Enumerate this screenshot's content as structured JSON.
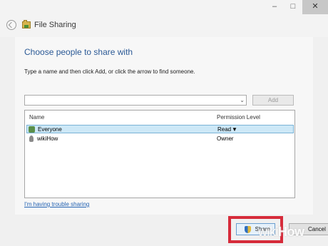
{
  "window": {
    "minimize_glyph": "–",
    "maximize_glyph": "□",
    "close_glyph": "✕"
  },
  "header": {
    "title": "File Sharing"
  },
  "main": {
    "heading": "Choose people to share with",
    "instruction": "Type a name and then click Add, or click the arrow to find someone.",
    "name_input_value": "",
    "dropdown_glyph": "⌄",
    "add_label": "Add"
  },
  "list": {
    "columns": [
      "Name",
      "Permission Level"
    ],
    "rows": [
      {
        "name": "Everyone",
        "permission": "Read",
        "icon": "group-icon",
        "selected": true,
        "has_dropdown": true
      },
      {
        "name": "wikiHow",
        "permission": "Owner",
        "icon": "user-icon",
        "selected": false,
        "has_dropdown": false
      }
    ],
    "permission_dropdown_glyph": "▼"
  },
  "footer": {
    "trouble_link": "I'm having trouble sharing",
    "share_label": "Share",
    "cancel_label": "Cancel"
  },
  "watermark": {
    "part1": "wiki",
    "part2": "How"
  },
  "colors": {
    "accent_heading": "#2c5a96",
    "link": "#2463b3",
    "highlight_box": "#d62b3a",
    "selection": "#cde8f7"
  }
}
